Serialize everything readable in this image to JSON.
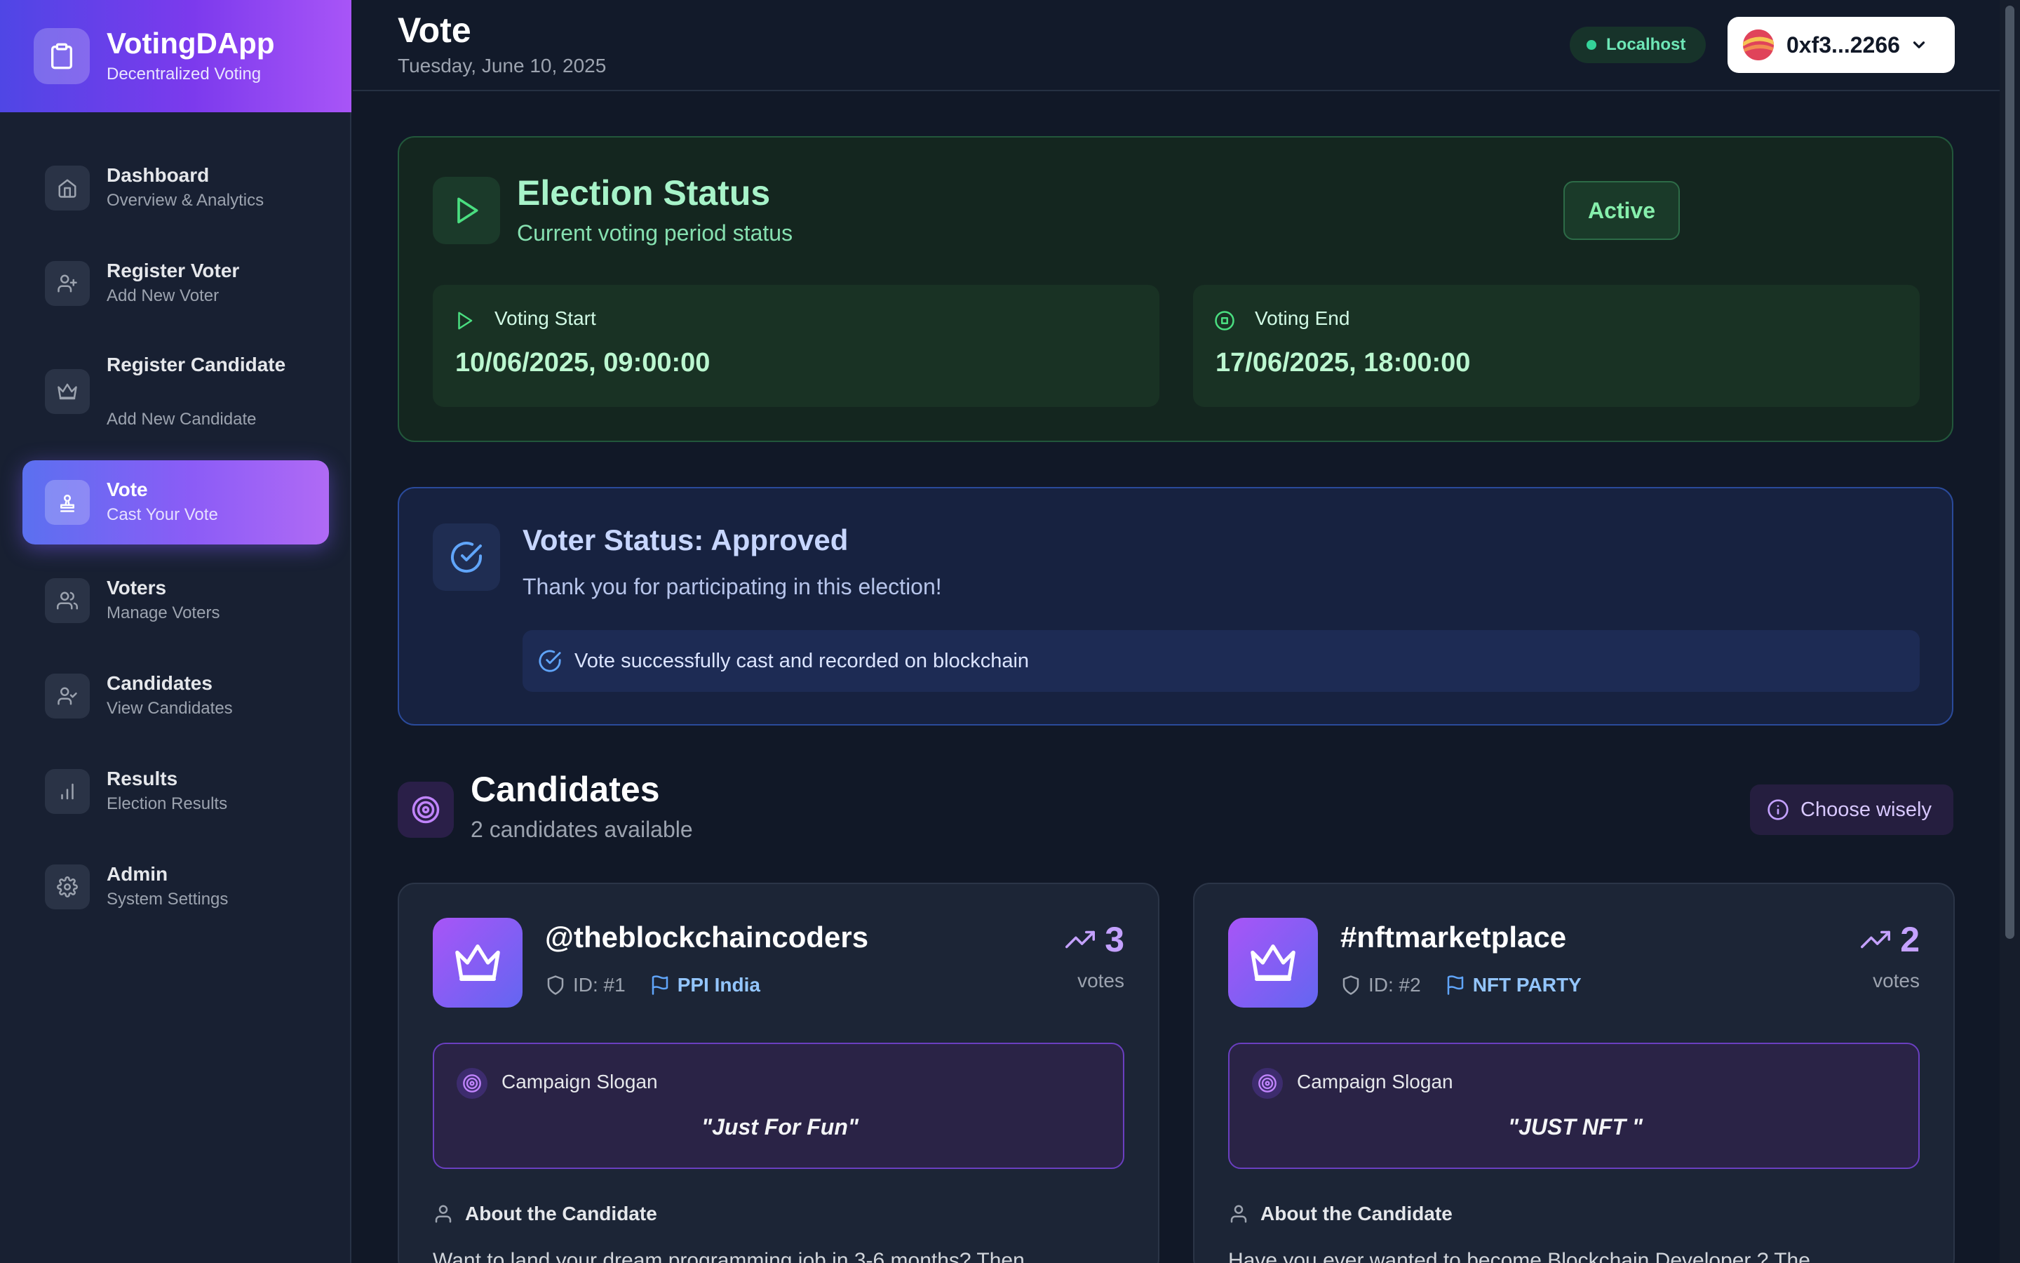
{
  "brand": {
    "name": "VotingDApp",
    "tagline": "Decentralized Voting",
    "icon": "clipboard-icon"
  },
  "sidebar": {
    "items": [
      {
        "title": "Dashboard",
        "subtitle": "Overview & Analytics",
        "icon": "home-icon",
        "active": false
      },
      {
        "title": "Register Voter",
        "subtitle": "Add New Voter",
        "icon": "user-plus-icon",
        "active": false
      },
      {
        "title": "Register Candidate",
        "subtitle": "Add New Candidate",
        "icon": "crown-icon",
        "active": false
      },
      {
        "title": "Vote",
        "subtitle": "Cast Your Vote",
        "icon": "vote-stamp-icon",
        "active": true
      },
      {
        "title": "Voters",
        "subtitle": "Manage Voters",
        "icon": "users-icon",
        "active": false
      },
      {
        "title": "Candidates",
        "subtitle": "View Candidates",
        "icon": "user-check-icon",
        "active": false
      },
      {
        "title": "Results",
        "subtitle": "Election Results",
        "icon": "bar-chart-icon",
        "active": false
      },
      {
        "title": "Admin",
        "subtitle": "System Settings",
        "icon": "gear-icon",
        "active": false
      }
    ]
  },
  "header": {
    "title": "Vote",
    "date": "Tuesday, June 10, 2025",
    "network": "Localhost",
    "wallet": "0xf3...2266"
  },
  "election": {
    "title": "Election Status",
    "subtitle": "Current voting period status",
    "status": "Active",
    "start_label": "Voting Start",
    "start_value": "10/06/2025, 09:00:00",
    "end_label": "Voting End",
    "end_value": "17/06/2025, 18:00:00"
  },
  "voter": {
    "title": "Voter Status: Approved",
    "message": "Thank you for participating in this election!",
    "banner": "Vote successfully cast and recorded on blockchain"
  },
  "candidates_section": {
    "title": "Candidates",
    "subtitle": "2 candidates available",
    "hint": "Choose wisely"
  },
  "candidates": [
    {
      "name": "@theblockchaincoders",
      "id": "ID: #1",
      "party": "PPI India",
      "votes": "3",
      "votes_label": "votes",
      "slogan_label": "Campaign Slogan",
      "slogan": "\"Just For Fun\"",
      "about_label": "About the Candidate",
      "about": "Want to land your dream programming job in 3-6 months? Then"
    },
    {
      "name": "#nftmarketplace",
      "id": "ID: #2",
      "party": "NFT PARTY",
      "votes": "2",
      "votes_label": "votes",
      "slogan_label": "Campaign Slogan",
      "slogan": "\"JUST NFT \"",
      "about_label": "About the Candidate",
      "about": "Have you ever wanted to become Blockchain Developer ? The"
    }
  ],
  "colors": {
    "accent": "#8b5cf6",
    "success": "#86efac",
    "info": "#93c5fd"
  }
}
